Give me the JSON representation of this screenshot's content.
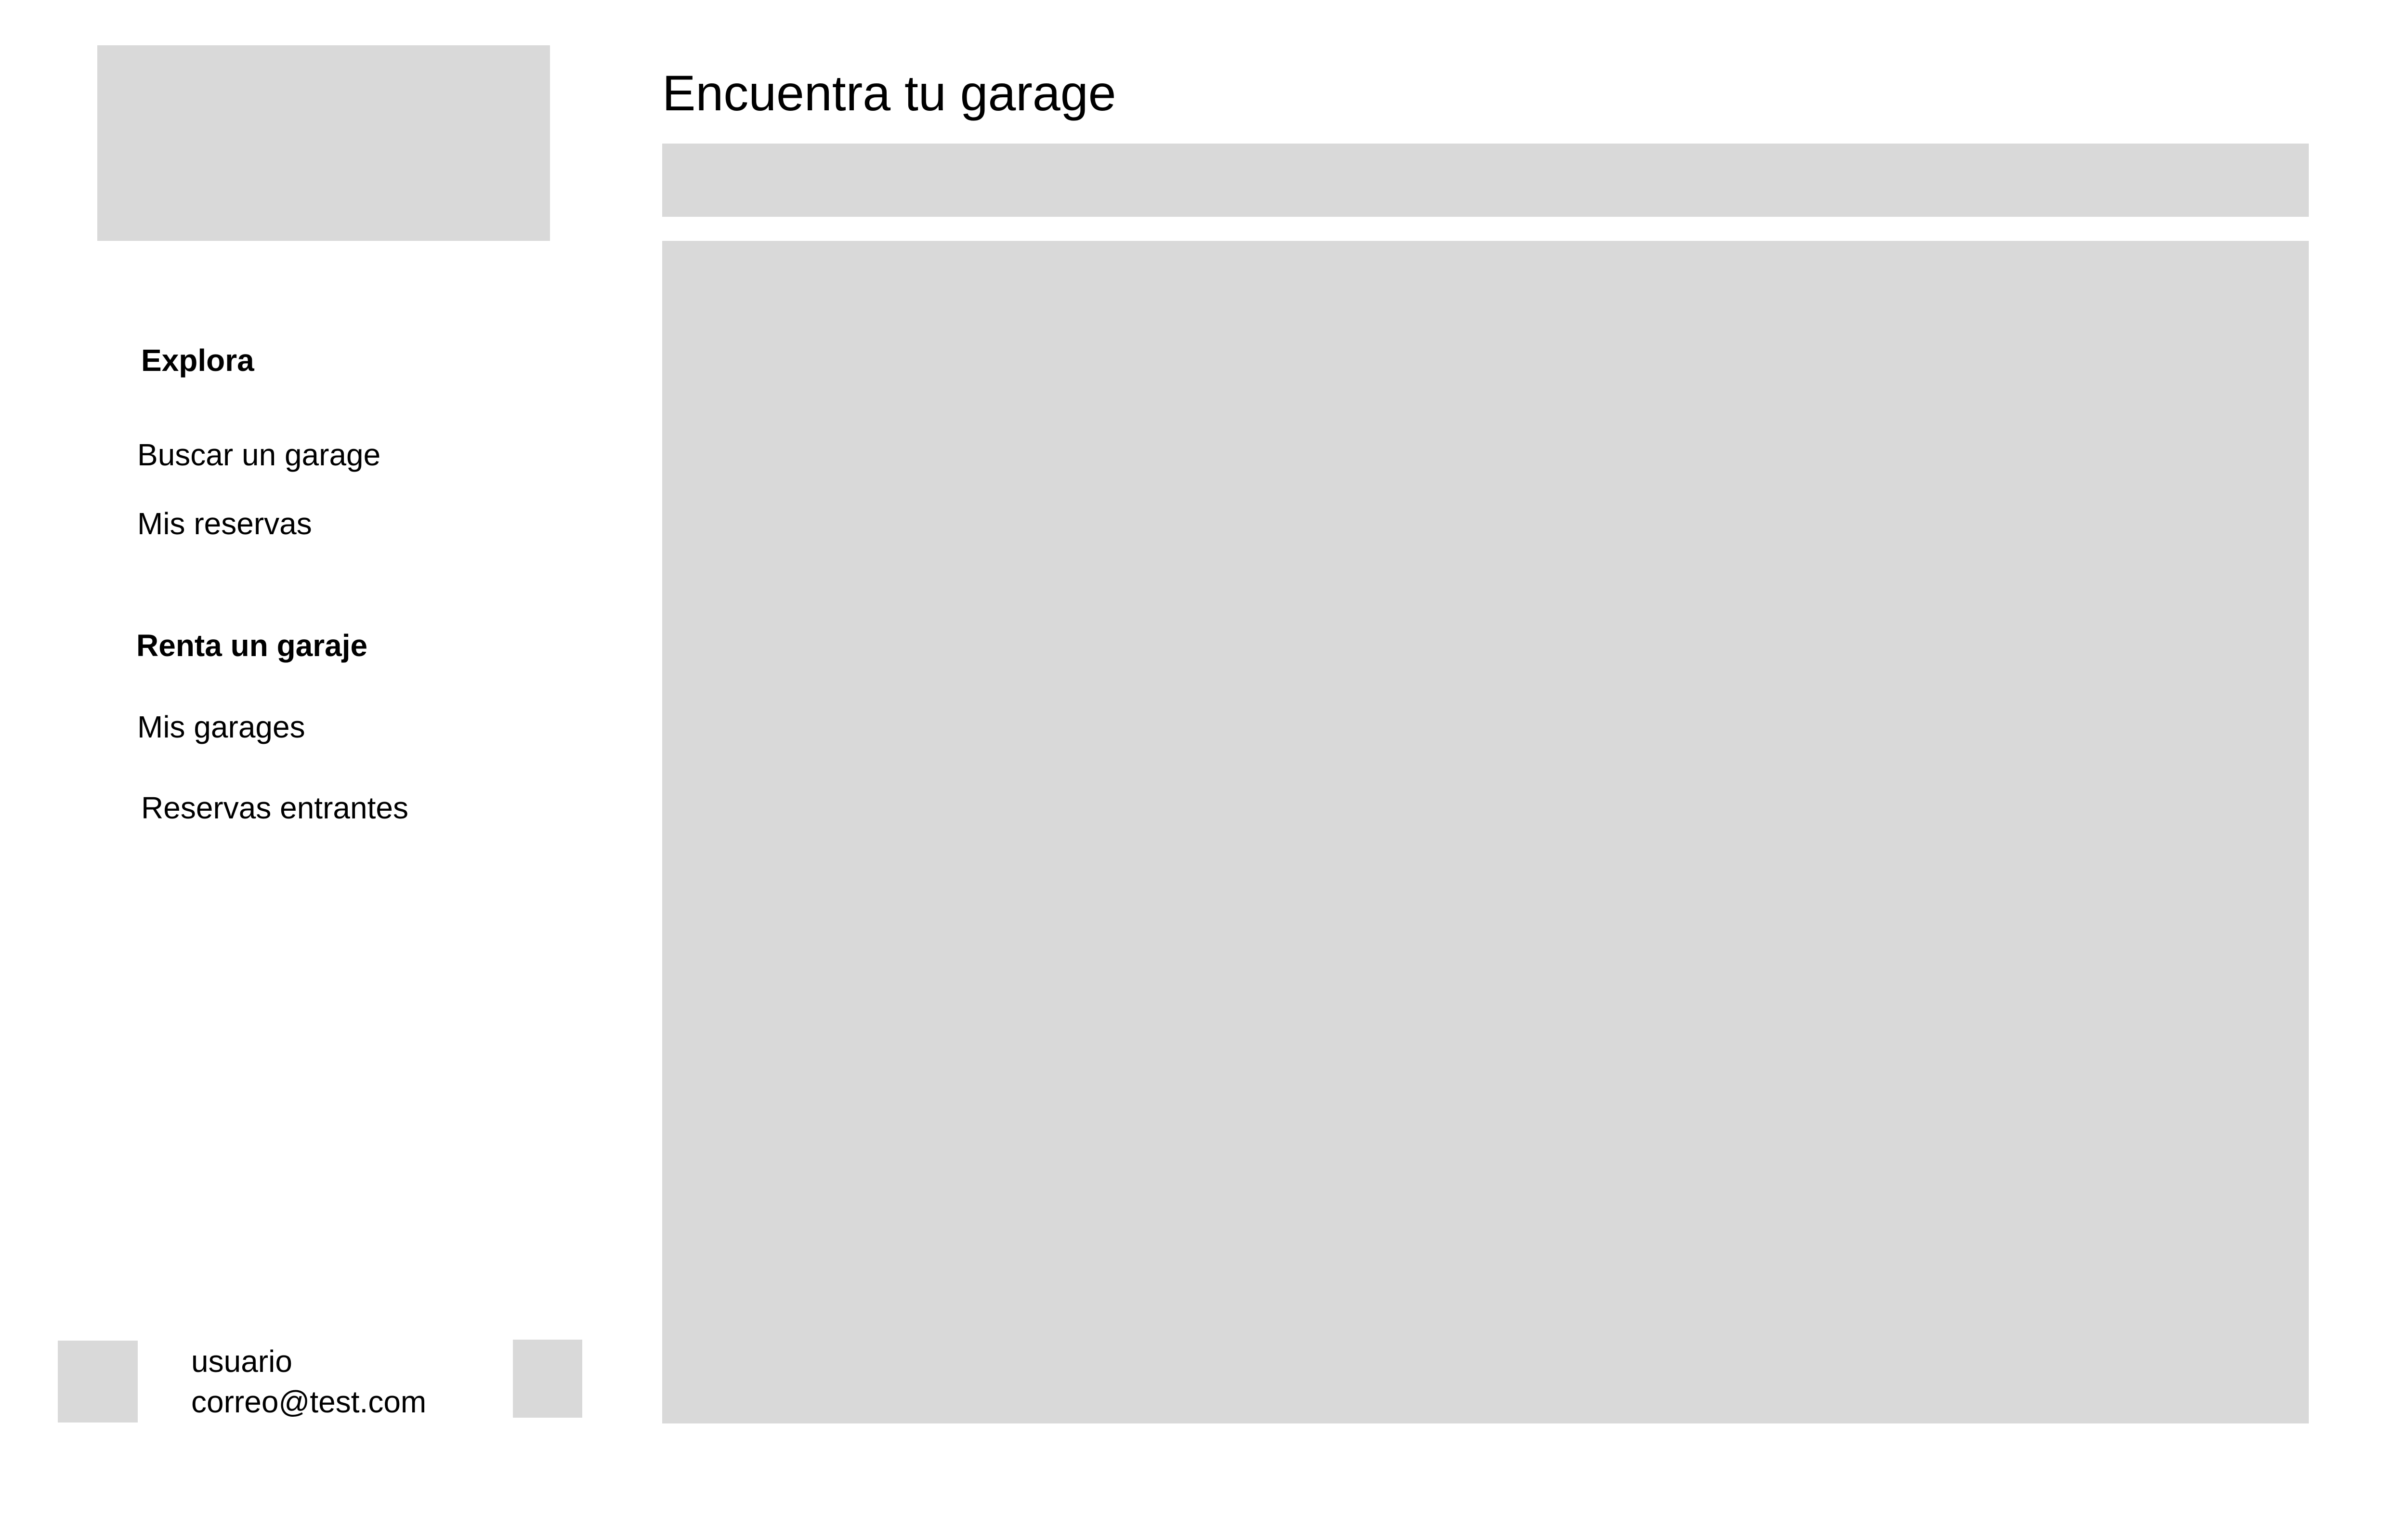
{
  "main": {
    "title": "Encuentra tu garage"
  },
  "sidebar": {
    "sections": [
      {
        "heading": "Explora",
        "items": [
          {
            "label": "Buscar un garage"
          },
          {
            "label": "Mis reservas"
          }
        ]
      },
      {
        "heading": "Renta un garaje",
        "items": [
          {
            "label": "Mis garages"
          },
          {
            "label": "Reservas entrantes"
          }
        ]
      }
    ]
  },
  "user": {
    "name": "usuario",
    "email": "correo@test.com"
  },
  "colors": {
    "placeholder": "#d9d9d9",
    "background": "#ffffff",
    "text": "#000000"
  }
}
